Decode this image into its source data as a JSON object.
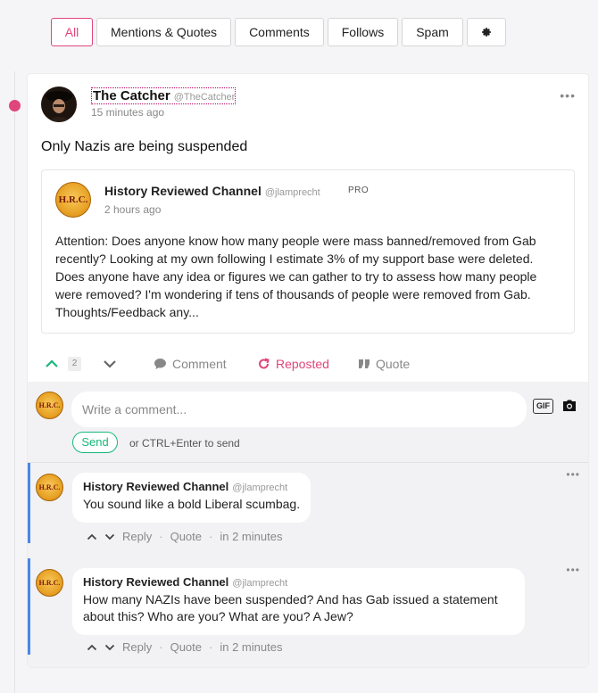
{
  "filters": {
    "all": "All",
    "mentions": "Mentions & Quotes",
    "comments": "Comments",
    "follows": "Follows",
    "spam": "Spam",
    "settings_icon": "gear-icon"
  },
  "post": {
    "author": "The Catcher",
    "handle": "@TheCatcher",
    "time": "15 minutes ago",
    "text": "Only Nazis are being suspended",
    "more": "•••",
    "quoted": {
      "author": "History Reviewed Channel",
      "handle": "@jlamprecht",
      "badge": "PRO",
      "avatar_text": "H.R.C.",
      "time": "2 hours ago",
      "text": "Attention: Does anyone know how many people were mass banned/removed from Gab recently? Looking at my own following I estimate 3% of my support base were deleted. Does anyone have any idea or figures we can gather to try to assess how many people were removed? I'm wondering if tens of thousands of people were removed from Gab. Thoughts/Feedback any..."
    },
    "actions": {
      "upvotes": "2",
      "comment": "Comment",
      "reposted": "Reposted",
      "quote": "Quote"
    }
  },
  "composer": {
    "placeholder": "Write a comment...",
    "gif": "GIF",
    "send": "Send",
    "hint": "or CTRL+Enter to send"
  },
  "comments": [
    {
      "author": "History Reviewed Channel",
      "handle": "@jlamprecht",
      "text": "You sound like a bold Liberal scumbag.",
      "reply": "Reply",
      "quote": "Quote",
      "time": "in 2 minutes"
    },
    {
      "author": "History Reviewed Channel",
      "handle": "@jlamprecht",
      "text": "How many NAZIs have been suspended? And has Gab issued a statement about this? Who are you? What are you? A Jew?",
      "reply": "Reply",
      "quote": "Quote",
      "time": "in 2 minutes"
    }
  ],
  "colors": {
    "accent": "#e0457b",
    "green": "#17b97a",
    "thread_bar": "#4a86e8"
  }
}
